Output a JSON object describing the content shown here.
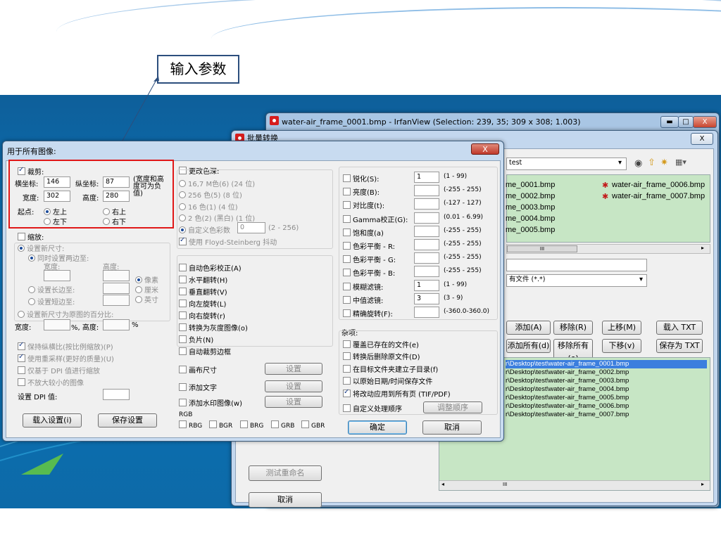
{
  "callout": {
    "text": "输入参数"
  },
  "irfan": {
    "title": "water-air_frame_0001.bmp - IrfanView (Selection: 239, 35; 309 x 308; 1.003)",
    "min": "▬",
    "max": "□",
    "close": "X"
  },
  "batch": {
    "title": "批量转换",
    "close": "X",
    "folder": "test",
    "files_left": [
      "me_0001.bmp",
      "me_0002.bmp",
      "me_0003.bmp",
      "me_0004.bmp",
      "me_0005.bmp"
    ],
    "files_right": [
      "water-air_frame_0006.bmp",
      "water-air_frame_0007.bmp"
    ],
    "filter_value": "有文件 (*.*)",
    "buttons": {
      "add": "添加(A)",
      "remove": "移除(R)",
      "move_up": "上移(M)",
      "load_txt": "载入 TXT",
      "add_all": "添加所有(d)",
      "remove_all": "移除所有(e)",
      "move_down": "下移(v)",
      "save_txt": "保存为 TXT"
    },
    "paths": [
      "r\\Desktop\\test\\water-air_frame_0001.bmp",
      "r\\Desktop\\test\\water-air_frame_0002.bmp",
      "r\\Desktop\\test\\water-air_frame_0003.bmp",
      "r\\Desktop\\test\\water-air_frame_0004.bmp",
      "r\\Desktop\\test\\water-air_frame_0005.bmp",
      "r\\Desktop\\test\\water-air_frame_0006.bmp",
      "r\\Desktop\\test\\water-air_frame_0007.bmp"
    ],
    "test_rename": "测试重命名",
    "cancel": "取消",
    "scroll_mark": "III"
  },
  "dlg": {
    "title": "用于所有图像:",
    "crop": {
      "label": "裁剪:",
      "x_label": "横坐标:",
      "x_value": "146",
      "y_label": "纵坐标:",
      "y_value": "87",
      "note": "(宽度和高度可为负值)",
      "w_label": "宽度:",
      "w_value": "302",
      "h_label": "高度:",
      "h_value": "280",
      "origin_label": "起点:",
      "tl": "左上",
      "tr": "右上",
      "bl": "左下",
      "br": "右下"
    },
    "resize": {
      "label": "缩放:",
      "set_new": "设置新尺寸:",
      "both_sides": "同时设置两边至:",
      "width": "宽度:",
      "height": "高度:",
      "pixels": "像素",
      "cm": "厘米",
      "inch": "英寸",
      "long_side": "设置长边至:",
      "short_side": "设置短边至:",
      "percent": "设置新尺寸为原图的百分比:",
      "pw": "宽度:",
      "pct": "%, 高度:",
      "pct2": "%"
    },
    "opts": {
      "keep_ratio": "保持纵横比(按比例缩放)(P)",
      "resample": "使用重采样(更好的质量)(U)",
      "dpi_only": "仅基于 DPI 值进行缩放",
      "no_enlarge": "不放大较小的图像",
      "set_dpi": "设置 DPI 值:"
    },
    "load_settings": "载入设置(i)",
    "save_settings": "保存设置",
    "color": {
      "label": "更改色深:",
      "c16m": "16,7 M色(6) (24 位)",
      "c256": "256 色(5) (8 位)",
      "c16": "16 色(1) (4 位)",
      "c2": "2 色(2) (黑白) (1 位)",
      "custom": "自定义色彩数",
      "custom_value": "0",
      "custom_range": "(2 - 256)",
      "floyd": "使用 Floyd-Steinberg 抖动"
    },
    "transforms": [
      "自动色彩校正(A)",
      "水平翻转(H)",
      "垂直翻转(V)",
      "向左旋转(L)",
      "向右旋转(r)",
      "转换为灰度图像(o)",
      "负片(N)",
      "自动裁剪边框"
    ],
    "canvas": "画布尺寸",
    "add_text": "添加文字",
    "add_watermark": "添加水印图像(w)",
    "setup": "设置",
    "rgb": {
      "label": "RGB",
      "items": [
        "RBG",
        "BGR",
        "BRG",
        "GRB",
        "GBR"
      ]
    },
    "adjust": [
      {
        "label": "锐化(S):",
        "value": "1",
        "range": "(1 - 99)"
      },
      {
        "label": "亮度(B):",
        "value": "",
        "range": "(-255 - 255)"
      },
      {
        "label": "对比度(t):",
        "value": "",
        "range": "(-127 - 127)"
      },
      {
        "label": "Gamma校正(G):",
        "value": "",
        "range": "(0.01 - 6.99)"
      },
      {
        "label": "饱和度(a)",
        "value": "",
        "range": "(-255 - 255)"
      },
      {
        "label": "色彩平衡 - R:",
        "value": "",
        "range": "(-255 - 255)"
      },
      {
        "label": "色彩平衡 - G:",
        "value": "",
        "range": "(-255 - 255)"
      },
      {
        "label": "色彩平衡 - B:",
        "value": "",
        "range": "(-255 - 255)"
      },
      {
        "label": "模糊滤镜:",
        "value": "1",
        "range": "(1 - 99)"
      },
      {
        "label": "中值滤镜:",
        "value": "3",
        "range": "(3 - 9)"
      },
      {
        "label": "精确旋转(F):",
        "value": "",
        "range": "(-360.0-360.0)"
      }
    ],
    "misc": {
      "label": "杂项:",
      "overwrite": "覆盖已存在的文件(e)",
      "delete_after": "转换后删除原文件(D)",
      "subdir": "在目标文件夹建立子目录(f)",
      "keep_date": "以原始日期/时间保存文件",
      "all_pages": "将改动应用到所有页 (TIF/PDF)",
      "custom_order": "自定义处理顺序",
      "adjust_order": "调整顺序"
    },
    "ok": "确定",
    "cancel": "取消",
    "close": "X"
  }
}
